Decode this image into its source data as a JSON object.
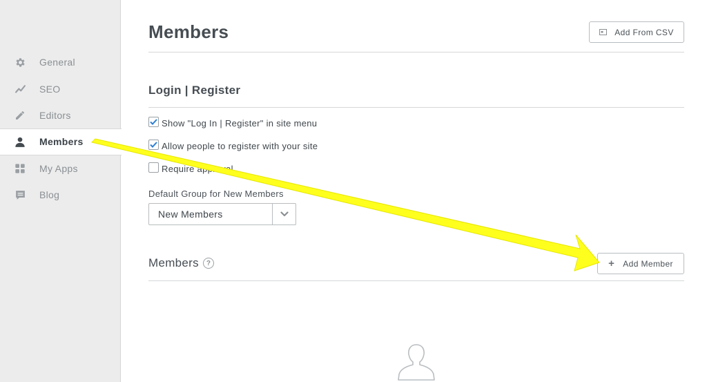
{
  "sidebar": {
    "items": [
      {
        "label": "General",
        "icon": "gear-icon",
        "active": false
      },
      {
        "label": "SEO",
        "icon": "trend-icon",
        "active": false
      },
      {
        "label": "Editors",
        "icon": "pencil-icon",
        "active": false
      },
      {
        "label": "Members",
        "icon": "person-icon",
        "active": true
      },
      {
        "label": "My Apps",
        "icon": "grid-icon",
        "active": false
      },
      {
        "label": "Blog",
        "icon": "comment-icon",
        "active": false
      }
    ]
  },
  "header": {
    "title": "Members",
    "add_csv_label": "Add From CSV"
  },
  "login_section": {
    "title": "Login | Register",
    "options": [
      {
        "label": "Show \"Log In | Register\" in site menu",
        "checked": true
      },
      {
        "label": "Allow people to register with your site",
        "checked": true
      },
      {
        "label": "Require approval",
        "checked": false
      }
    ],
    "default_group_label": "Default Group for New Members",
    "default_group_value": "New Members"
  },
  "members_section": {
    "title": "Members",
    "help_glyph": "?",
    "add_member_label": "Add Member",
    "add_member_glyph": "+"
  },
  "colors": {
    "sidebar_bg": "#ececec",
    "check_blue": "#2a7fd4",
    "annotation_arrow": "#ffff1e"
  }
}
